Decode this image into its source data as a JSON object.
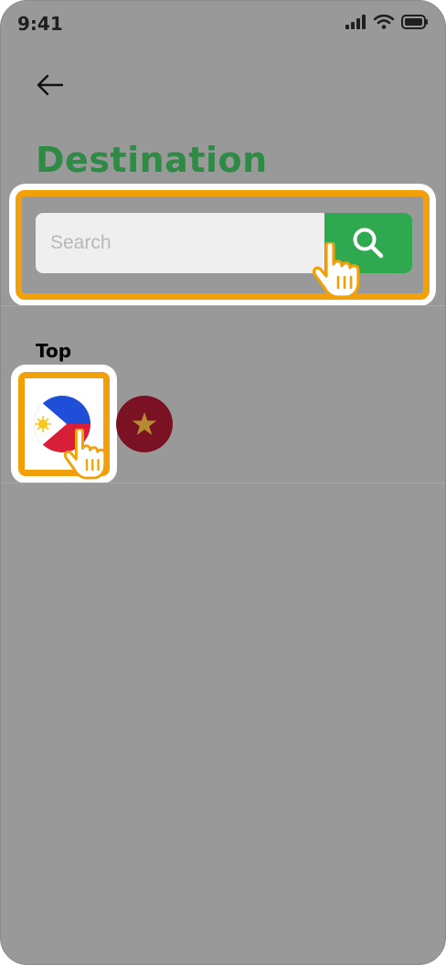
{
  "status_bar": {
    "time": "9:41"
  },
  "header": {
    "title": "Destination"
  },
  "search": {
    "placeholder": "Search"
  },
  "top_section": {
    "title": "Top",
    "destinations": [
      {
        "icon": "philippines-flag-icon"
      },
      {
        "icon": "vietnam-flag-icon"
      }
    ]
  },
  "colors": {
    "accent_green": "#2fa94f",
    "title_green": "#2e8a45",
    "highlight_orange": "#f2a007",
    "overlay_gray": "#999999"
  }
}
